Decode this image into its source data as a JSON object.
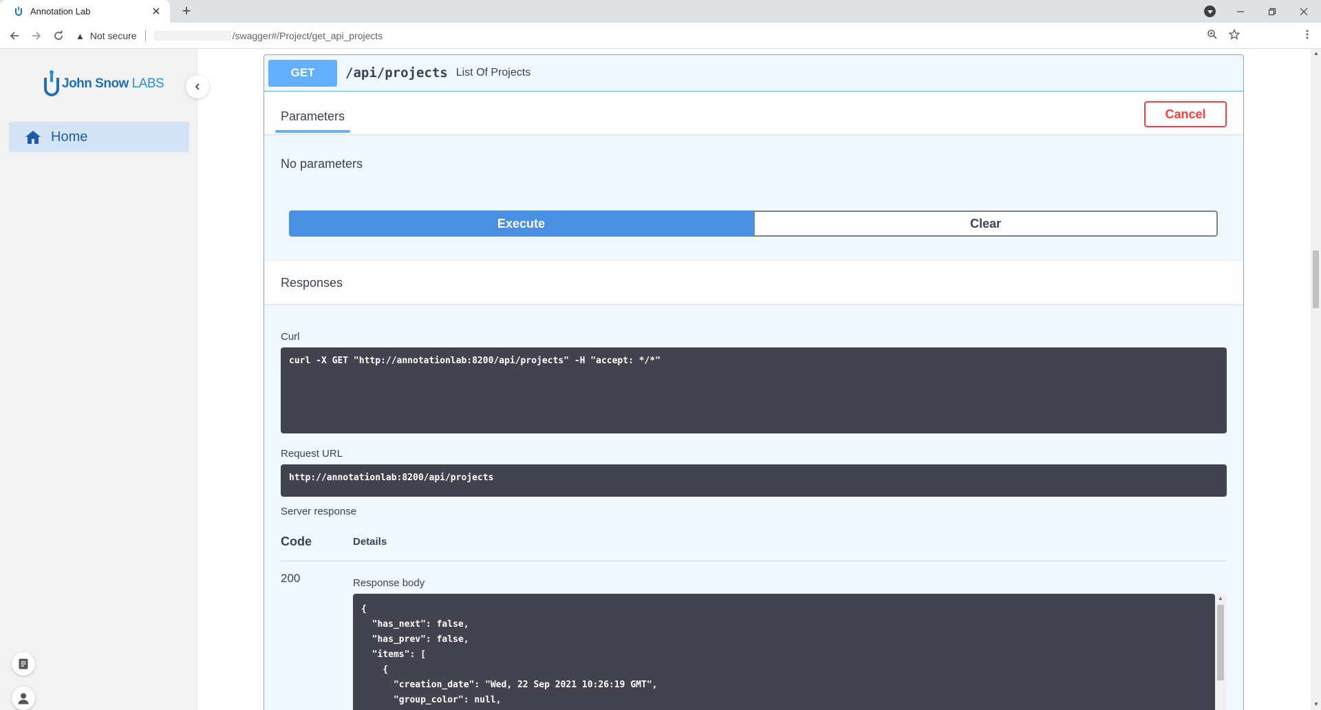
{
  "browser": {
    "tab_title": "Annotation Lab",
    "tab_close": "✕",
    "new_tab": "+",
    "security_label": "Not secure",
    "url_path": "/swagger#/Project/get_api_projects"
  },
  "sidebar": {
    "logo_text_main": "John Snow ",
    "logo_text_labs": "LABS",
    "home_label": "Home"
  },
  "operation": {
    "method": "GET",
    "path": "/api/projects",
    "description": "List Of Projects",
    "parameters_tab": "Parameters",
    "cancel_label": "Cancel",
    "no_params": "No parameters",
    "execute_label": "Execute",
    "clear_label": "Clear"
  },
  "responses": {
    "title": "Responses",
    "curl_label": "Curl",
    "curl_command": "curl -X GET \"http://annotationlab:8200/api/projects\" -H \"accept: */*\"",
    "request_url_label": "Request URL",
    "request_url": "http://annotationlab:8200/api/projects",
    "server_response_label": "Server response",
    "code_header": "Code",
    "details_header": "Details",
    "status_code": "200",
    "response_body_label": "Response body",
    "response_body": "{\n  \"has_next\": false,\n  \"has_prev\": false,\n  \"items\": [\n    {\n      \"creation_date\": \"Wed, 22 Sep 2021 10:26:19 GMT\",\n      \"group_color\": null,"
  },
  "colors": {
    "get_blue": "#61affe",
    "execute_blue": "#4990e2",
    "cancel_red": "#f93e3e",
    "code_bg": "#41444e"
  }
}
